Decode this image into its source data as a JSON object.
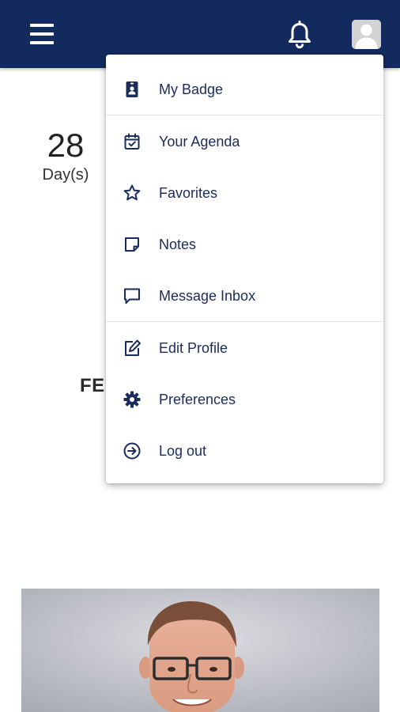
{
  "header": {
    "menu_icon": "hamburger-icon",
    "notification_icon": "bell-icon",
    "profile_icon": "user-avatar-icon",
    "bar_color": "#122a5e"
  },
  "countdown": {
    "value": "28",
    "unit": "Day(s)"
  },
  "partial_heading": "FE",
  "user_menu": {
    "items": [
      {
        "label": "My Badge",
        "icon": "badge-icon"
      },
      {
        "label": "Your Agenda",
        "icon": "calendar-check-icon"
      },
      {
        "label": "Favorites",
        "icon": "star-icon"
      },
      {
        "label": "Notes",
        "icon": "note-icon"
      },
      {
        "label": "Message Inbox",
        "icon": "message-icon"
      },
      {
        "label": "Edit Profile",
        "icon": "edit-icon"
      },
      {
        "label": "Preferences",
        "icon": "gear-icon"
      },
      {
        "label": "Log out",
        "icon": "logout-icon"
      }
    ],
    "text_color": "#1a2b5c"
  }
}
